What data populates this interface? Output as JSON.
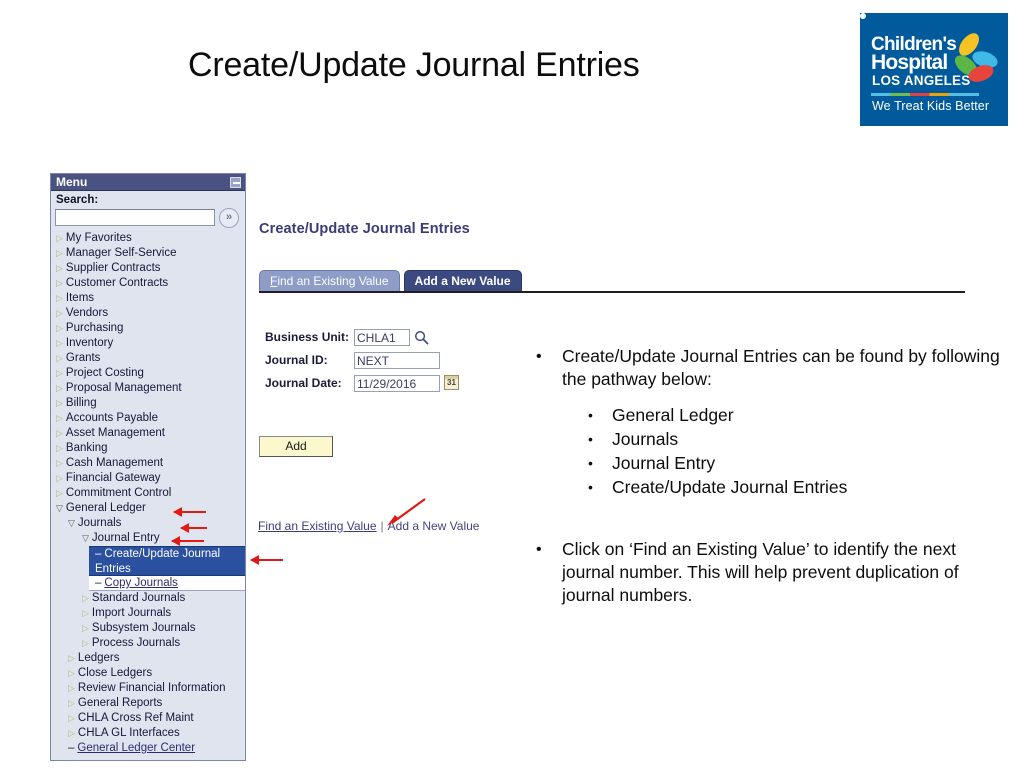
{
  "slide": {
    "title": "Create/Update Journal Entries"
  },
  "logo": {
    "line1": "Children's",
    "line2": "Hospital",
    "line3": "LOS ANGELES",
    "tagline": "We Treat Kids Better",
    "bg_color": "#005a9c",
    "petal_colors": [
      "#f6c324",
      "#3fb9e5",
      "#5cb646",
      "#e8443c"
    ]
  },
  "menu": {
    "header_title": "Menu",
    "minimize_label": "",
    "search_label": "Search:",
    "search_value": "",
    "search_placeholder": "",
    "go_glyph": "»",
    "items": [
      {
        "label": "My Favorites",
        "level": 0,
        "marker": "closed"
      },
      {
        "label": "Manager Self-Service",
        "level": 0,
        "marker": "closed"
      },
      {
        "label": "Supplier Contracts",
        "level": 0,
        "marker": "closed"
      },
      {
        "label": "Customer Contracts",
        "level": 0,
        "marker": "closed"
      },
      {
        "label": "Items",
        "level": 0,
        "marker": "closed"
      },
      {
        "label": "Vendors",
        "level": 0,
        "marker": "closed"
      },
      {
        "label": "Purchasing",
        "level": 0,
        "marker": "closed"
      },
      {
        "label": "Inventory",
        "level": 0,
        "marker": "closed"
      },
      {
        "label": "Grants",
        "level": 0,
        "marker": "closed"
      },
      {
        "label": "Project Costing",
        "level": 0,
        "marker": "closed"
      },
      {
        "label": "Proposal Management",
        "level": 0,
        "marker": "closed"
      },
      {
        "label": "Billing",
        "level": 0,
        "marker": "closed"
      },
      {
        "label": "Accounts Payable",
        "level": 0,
        "marker": "closed"
      },
      {
        "label": "Asset Management",
        "level": 0,
        "marker": "closed"
      },
      {
        "label": "Banking",
        "level": 0,
        "marker": "closed"
      },
      {
        "label": "Cash Management",
        "level": 0,
        "marker": "closed"
      },
      {
        "label": "Financial Gateway",
        "level": 0,
        "marker": "closed"
      },
      {
        "label": "Commitment Control",
        "level": 0,
        "marker": "closed"
      },
      {
        "label": "General Ledger",
        "level": 0,
        "marker": "open"
      },
      {
        "label": "Journals",
        "level": 1,
        "marker": "open"
      },
      {
        "label": "Journal Entry",
        "level": 2,
        "marker": "open"
      },
      {
        "label": "Create/Update Journal Entries",
        "level": 3,
        "marker": "leaf",
        "state": "selected"
      },
      {
        "label": "Copy Journals",
        "level": 3,
        "marker": "leaf",
        "state": "link"
      },
      {
        "label": "Standard Journals",
        "level": 2,
        "marker": "closed"
      },
      {
        "label": "Import Journals",
        "level": 2,
        "marker": "closed"
      },
      {
        "label": "Subsystem Journals",
        "level": 2,
        "marker": "closed"
      },
      {
        "label": "Process Journals",
        "level": 2,
        "marker": "closed"
      },
      {
        "label": "Ledgers",
        "level": 1,
        "marker": "closed"
      },
      {
        "label": "Close Ledgers",
        "level": 1,
        "marker": "closed"
      },
      {
        "label": "Review Financial Information",
        "level": 1,
        "marker": "closed"
      },
      {
        "label": "General Reports",
        "level": 1,
        "marker": "closed"
      },
      {
        "label": "CHLA Cross Ref Maint",
        "level": 1,
        "marker": "closed"
      },
      {
        "label": "CHLA GL Interfaces",
        "level": 1,
        "marker": "closed"
      },
      {
        "label": "General Ledger Center",
        "level": 1,
        "marker": "leaf",
        "state": "link"
      }
    ]
  },
  "content": {
    "page_title": "Create/Update Journal Entries",
    "tabs": [
      {
        "label": "Find an Existing Value",
        "active": false
      },
      {
        "label": "Add a New Value",
        "active": true
      }
    ],
    "fields": [
      {
        "label": "Business Unit:",
        "value": "CHLA1"
      },
      {
        "label": "Journal ID:",
        "value": "NEXT"
      },
      {
        "label": "Journal Date:",
        "value": "11/29/2016"
      }
    ],
    "lookup_icon": "magnifier-icon",
    "calendar_icon_text": "31",
    "add_button": "Add",
    "bottom_links": {
      "left": "Find an Existing Value",
      "separator": "|",
      "right": "Add a New Value"
    }
  },
  "notes": {
    "bullet1": "Create/Update Journal Entries can be found by following the pathway below:",
    "pathway": [
      "General Ledger",
      "Journals",
      "Journal Entry",
      "Create/Update Journal Entries"
    ],
    "bullet2": "Click on ‘Find an Existing Value’ to identify the next journal number.  This will help prevent duplication of journal numbers.",
    "bullet_glyph": "•",
    "annotation_color": "#e01b15"
  }
}
